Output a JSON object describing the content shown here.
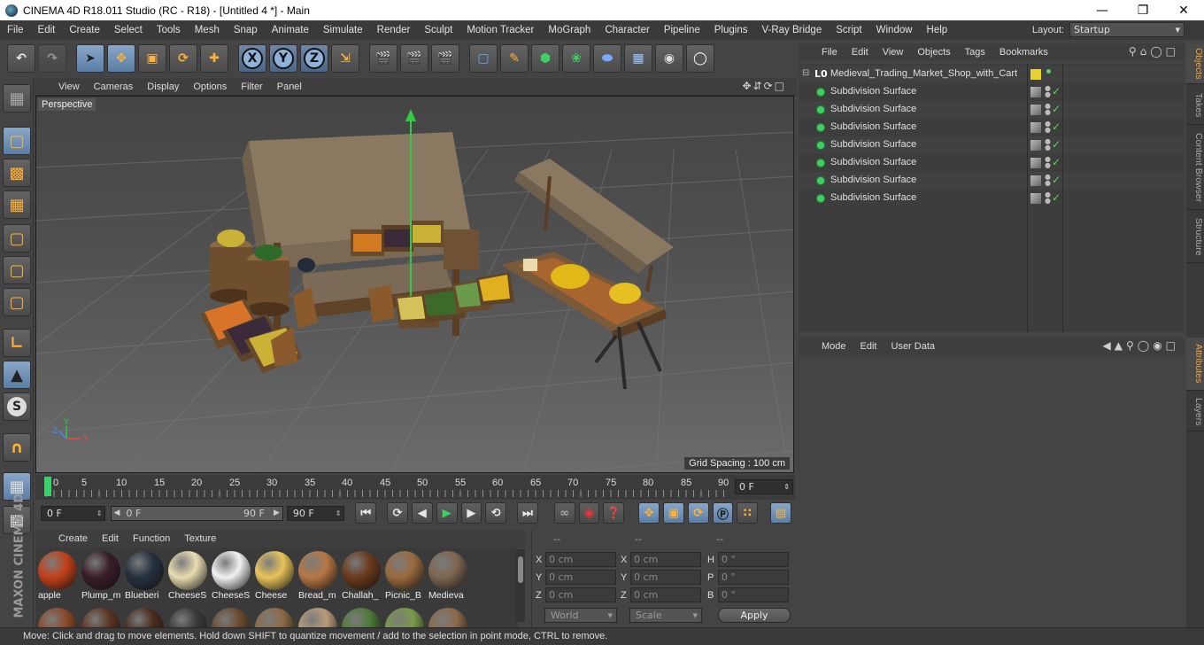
{
  "window": {
    "title": "CINEMA 4D R18.011 Studio (RC - R18) - [Untitled 4 *] - Main",
    "controls": [
      "minimize",
      "maximize",
      "close"
    ]
  },
  "menubar": {
    "items": [
      "File",
      "Edit",
      "Create",
      "Select",
      "Tools",
      "Mesh",
      "Snap",
      "Animate",
      "Simulate",
      "Render",
      "Sculpt",
      "Motion Tracker",
      "MoGraph",
      "Character",
      "Pipeline",
      "Plugins",
      "V-Ray Bridge",
      "Script",
      "Window",
      "Help"
    ],
    "layout_label": "Layout:",
    "layout_value": "Startup"
  },
  "main_toolbar": {
    "icons": [
      "undo-icon",
      "redo-icon",
      "live-select-icon",
      "move-icon",
      "scale-icon",
      "rotate-icon",
      "recent-tool-icon",
      "x-axis-icon",
      "y-axis-icon",
      "z-axis-icon",
      "coordinate-system-icon",
      "render-view-icon",
      "render-picture-viewer-icon",
      "edit-render-settings-icon",
      "cube-icon",
      "pen-icon",
      "subdivision-icon",
      "cloner-icon",
      "deformer-icon",
      "floor-icon",
      "camera-icon",
      "light-icon"
    ],
    "axis_labels": [
      "X",
      "Y",
      "Z"
    ]
  },
  "left_toolbar": {
    "icons": [
      "make-editable-icon",
      "model-mode-icon",
      "texture-mode-icon",
      "workplane-icon",
      "points-mode-icon",
      "edges-mode-icon",
      "polygons-mode-icon",
      "axis-mode-icon",
      "tweak-icon",
      "snap-icon",
      "magnet-icon",
      "locked-workplane-icon",
      "planar-workplane-icon"
    ],
    "snap_label": "S"
  },
  "viewport": {
    "menu": [
      "View",
      "Cameras",
      "Display",
      "Options",
      "Filter",
      "Panel"
    ],
    "label": "Perspective",
    "grid_spacing": "Grid Spacing : 100 cm",
    "axis_labels": [
      "Y",
      "Z",
      "X"
    ]
  },
  "timeline": {
    "ticks": [
      "0",
      "5",
      "10",
      "15",
      "20",
      "25",
      "30",
      "35",
      "40",
      "45",
      "50",
      "55",
      "60",
      "65",
      "70",
      "75",
      "80",
      "85",
      "90"
    ],
    "current_frame": "0 F"
  },
  "transport": {
    "start_frame": "0 F",
    "range_start": "0 F",
    "range_end": "90 F",
    "end_frame": "90 F"
  },
  "material_manager": {
    "menu": [
      "Create",
      "Edit",
      "Function",
      "Texture"
    ],
    "materials": [
      {
        "label": "apple",
        "color": "#c2401a"
      },
      {
        "label": "Plump_m",
        "color": "#3a1d2a"
      },
      {
        "label": "Blueberi",
        "color": "#263140"
      },
      {
        "label": "CheeseS",
        "color": "#e8dcb0"
      },
      {
        "label": "CheeseS",
        "color": "#f1f1f1"
      },
      {
        "label": "Cheese",
        "color": "#e9c35a"
      },
      {
        "label": "Bread_m",
        "color": "#b77744"
      },
      {
        "label": "Challah_",
        "color": "#6b3a1c"
      },
      {
        "label": "Picnic_B",
        "color": "#9a6a3e"
      },
      {
        "label": "Medieva",
        "color": "#7d6650"
      }
    ],
    "second_row_colors": [
      "#8a4a2a",
      "#5a3520",
      "#4a2d1e",
      "#3a3a3a",
      "#6a4a30",
      "#8b6a45",
      "#b89a7a",
      "#4e7a3a",
      "#7a9a4a",
      "#8a6a4a"
    ]
  },
  "coordinates": {
    "headers": [
      "--",
      "--",
      "--"
    ],
    "rows": [
      {
        "a": "X",
        "a_val": "0 cm",
        "b": "X",
        "b_val": "0 cm",
        "c": "H",
        "c_val": "0 °"
      },
      {
        "a": "Y",
        "a_val": "0 cm",
        "b": "Y",
        "b_val": "0 cm",
        "c": "P",
        "c_val": "0 °"
      },
      {
        "a": "Z",
        "a_val": "0 cm",
        "b": "Z",
        "b_val": "0 cm",
        "c": "B",
        "c_val": "0 °"
      }
    ],
    "mode_select": "World",
    "scale_select": "Scale",
    "apply_label": "Apply"
  },
  "object_manager": {
    "menu": [
      "File",
      "Edit",
      "View",
      "Objects",
      "Tags",
      "Bookmarks"
    ],
    "root": {
      "label": "Medieval_Trading_Market_Shop_with_Cart",
      "icon_text": "L0"
    },
    "children": [
      "Subdivision Surface",
      "Subdivision Surface",
      "Subdivision Surface",
      "Subdivision Surface",
      "Subdivision Surface",
      "Subdivision Surface",
      "Subdivision Surface"
    ]
  },
  "attribute_manager": {
    "menu": [
      "Mode",
      "Edit",
      "User Data"
    ]
  },
  "side_tabs": {
    "top": [
      {
        "label": "Objects",
        "active": true
      },
      {
        "label": "Takes",
        "active": false
      },
      {
        "label": "Content Browser",
        "active": false
      },
      {
        "label": "Structure",
        "active": false
      }
    ],
    "bottom": [
      {
        "label": "Attributes",
        "active": true
      },
      {
        "label": "Layers",
        "active": false
      }
    ]
  },
  "statusbar": {
    "text": "Move: Click and drag to move elements. Hold down SHIFT to quantize movement / add to the selection in point mode, CTRL to remove."
  },
  "branding": {
    "logo_text": "MAXON CINEMA 4D"
  }
}
